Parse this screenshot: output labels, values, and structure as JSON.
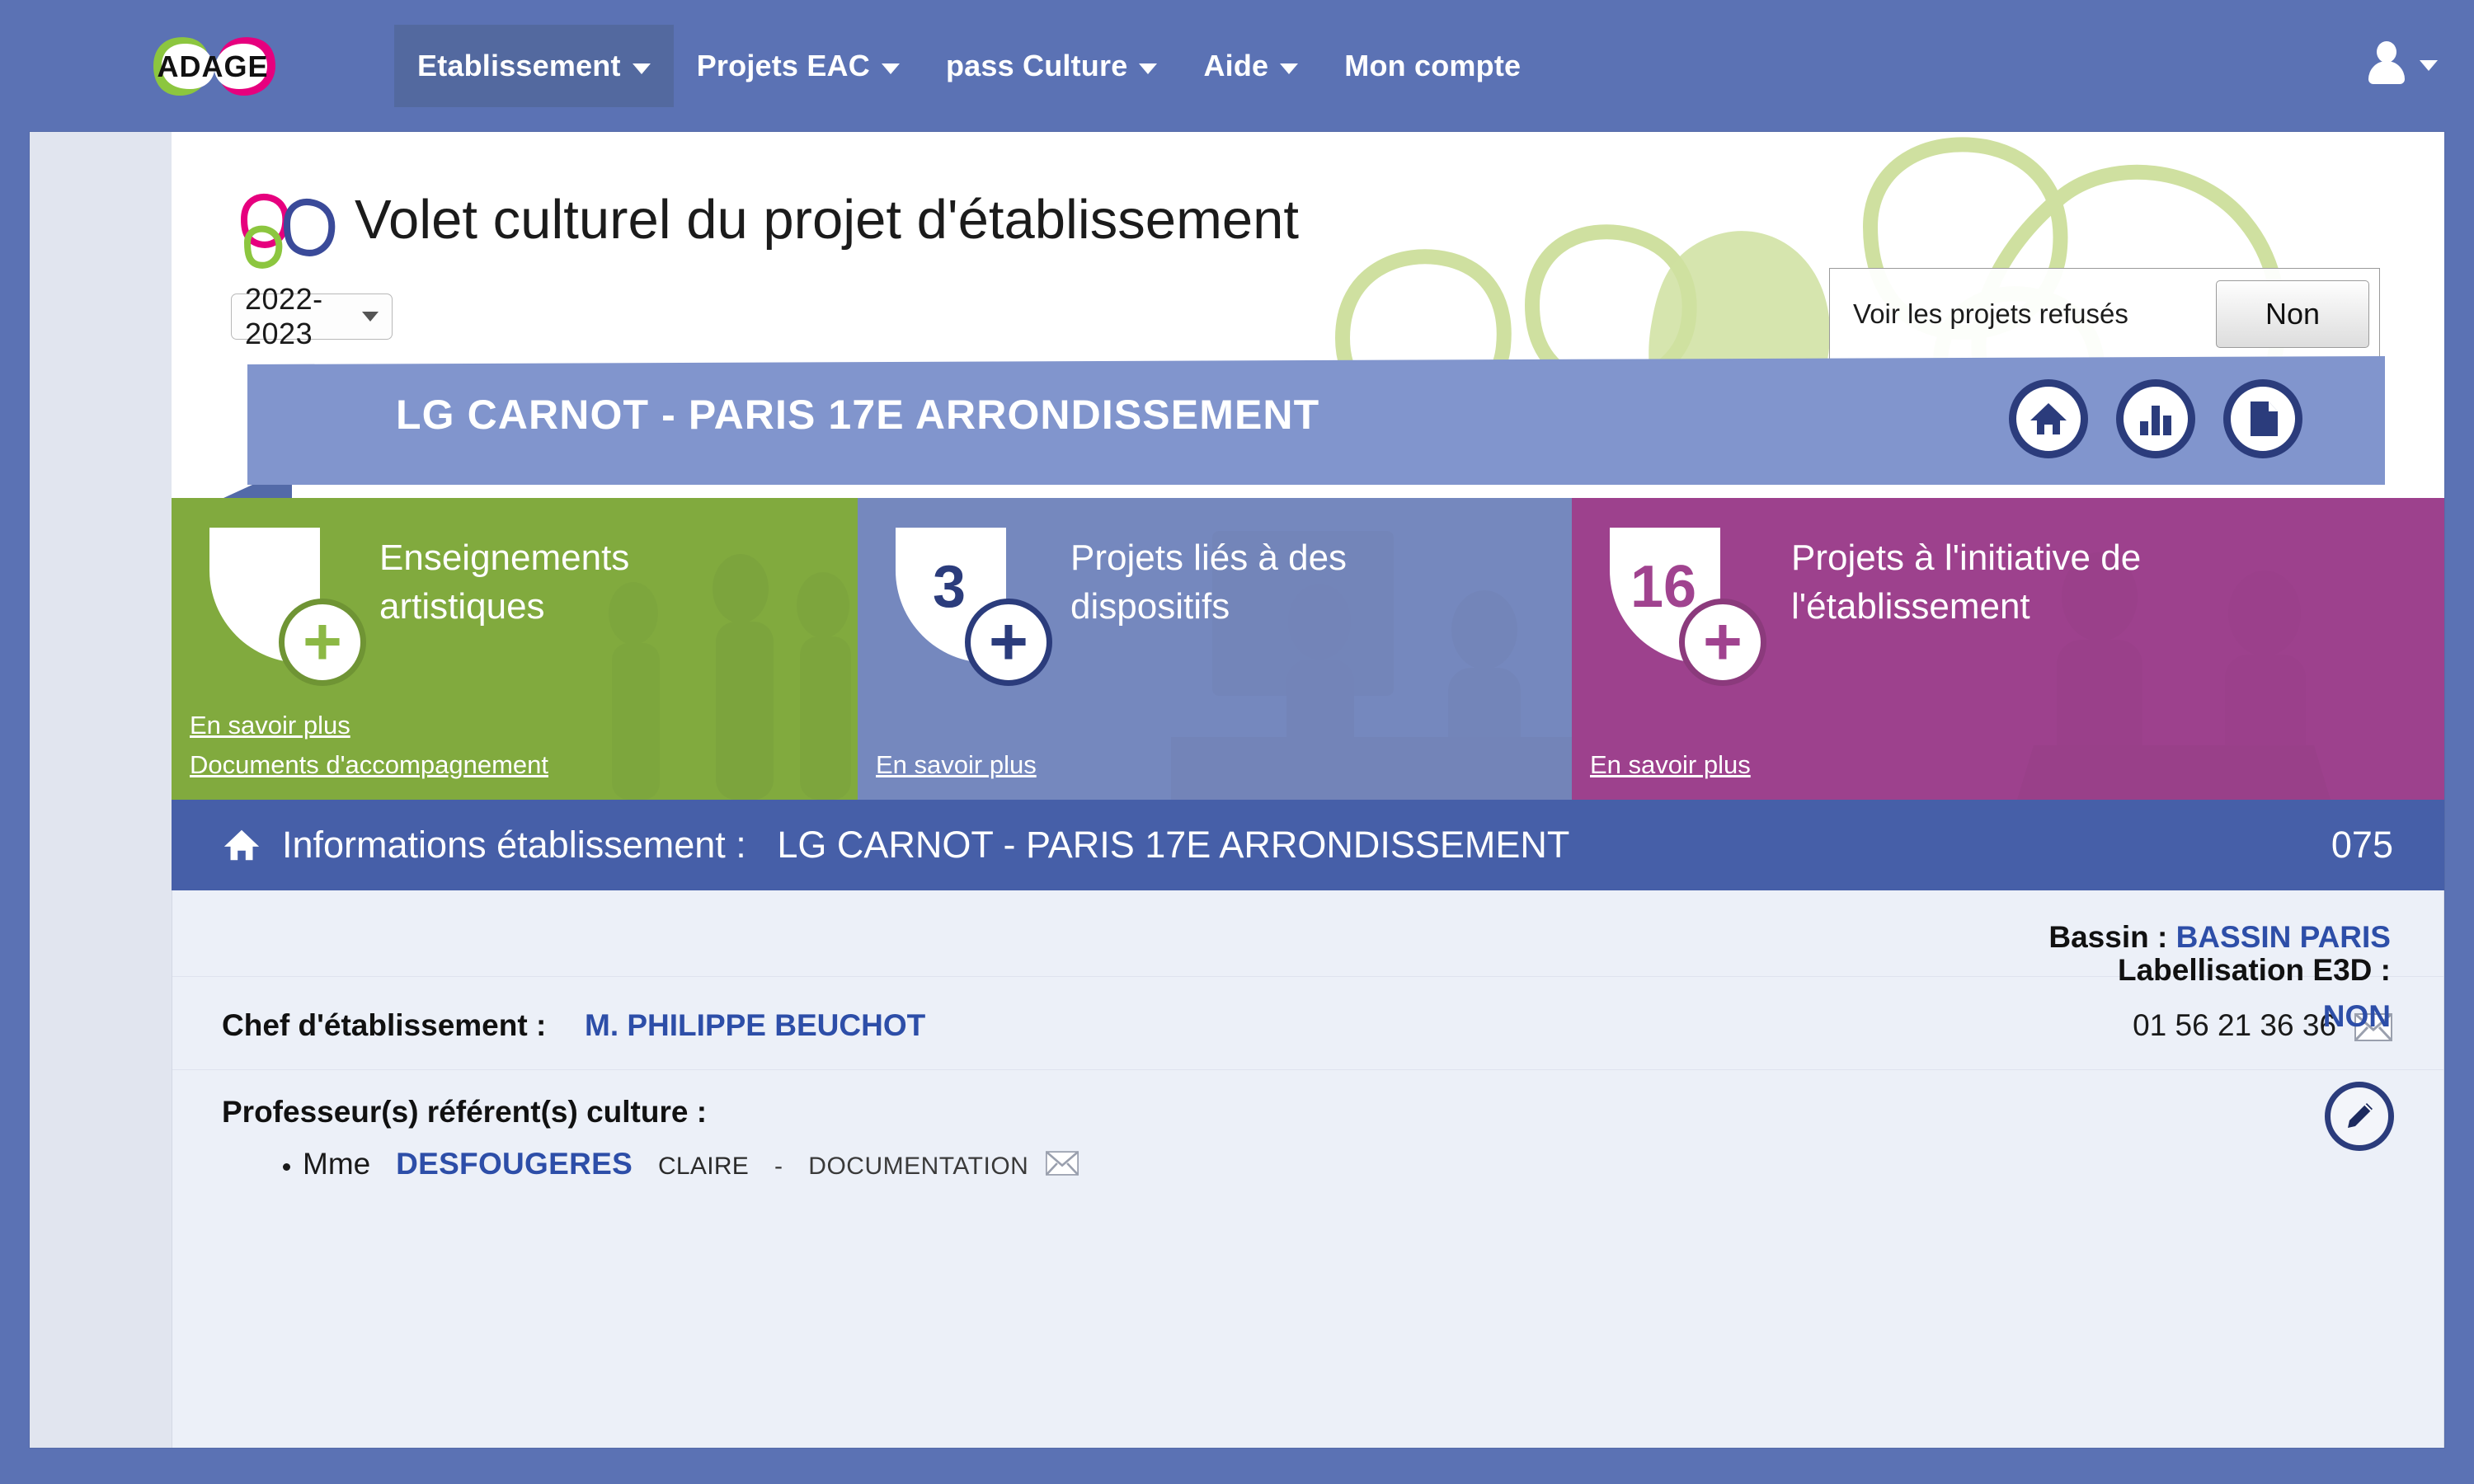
{
  "nav": {
    "logo_text": "ADAGE",
    "items": [
      {
        "label": "Etablissement",
        "has_caret": true,
        "active": true
      },
      {
        "label": "Projets EAC",
        "has_caret": true,
        "active": false
      },
      {
        "label": "pass Culture",
        "has_caret": true,
        "active": false
      },
      {
        "label": "Aide",
        "has_caret": true,
        "active": false
      },
      {
        "label": "Mon compte",
        "has_caret": false,
        "active": false
      }
    ],
    "user_icon": "user-icon",
    "user_caret": "chevron-down-icon"
  },
  "header": {
    "title": "Volet culturel du projet d'établissement",
    "year_selected": "2022-2023",
    "refused_label": "Voir les projets refusés",
    "refused_toggle_value": "Non"
  },
  "ribbon": {
    "title": "LG CARNOT - PARIS 17E ARRONDISSEMENT",
    "icons": [
      {
        "name": "home-icon"
      },
      {
        "name": "bar-chart-icon"
      },
      {
        "name": "document-icon"
      }
    ]
  },
  "cards": [
    {
      "id": "enseignements-artistiques",
      "count": "",
      "title": "Enseignements artistiques",
      "color": "#8cb845",
      "links": [
        "En savoir plus",
        "Documents d'accompagnement"
      ]
    },
    {
      "id": "projets-dispositifs",
      "count": "3",
      "title": "Projets liés à des dispositifs",
      "color": "#8396cd",
      "links": [
        "En savoir plus"
      ]
    },
    {
      "id": "projets-initiative",
      "count": "16",
      "title": "Projets à l'initiative de l'établissement",
      "color": "#ad4a9b",
      "links": [
        "En savoir plus"
      ]
    }
  ],
  "info_bar": {
    "icon": "home-icon",
    "label": "Informations établissement :",
    "establishment": "LG CARNOT - PARIS 17E ARRONDISSEMENT",
    "code": "075"
  },
  "details": {
    "bassin_label": "Bassin :",
    "bassin_value": "BASSIN PARIS",
    "chef_label": "Chef d'établissement :",
    "chef_value": "M. PHILIPPE BEUCHOT",
    "chef_phone": "01 56 21 36 36",
    "chef_mail_icon": "envelope-icon",
    "prof_label": "Professeur(s) référent(s) culture :",
    "professors": [
      {
        "civility": "Mme",
        "last_name": "DESFOUGERES",
        "first_name": "CLAIRE",
        "separator": "-",
        "discipline": "DOCUMENTATION",
        "mail_icon": "envelope-icon"
      }
    ],
    "e3d_label": "Labellisation E3D :",
    "e3d_value": "NON",
    "edit_icon": "pencil-icon"
  },
  "colors": {
    "nav_bg": "#5b72b4",
    "ribbon_bg": "#8195cd",
    "info_bar_bg": "#465fa8",
    "green": "#8cb845",
    "blue": "#8396cd",
    "pink": "#ad4a9b",
    "link_blue": "#2d4ea8",
    "dark_navy": "#2b3c7c"
  }
}
